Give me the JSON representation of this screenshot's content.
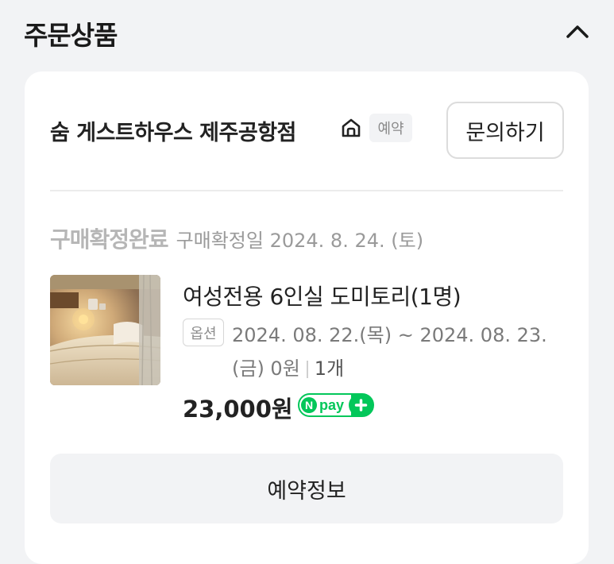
{
  "section": {
    "title": "주문상품",
    "collapse_icon": "chevron-up-icon"
  },
  "store": {
    "name": "숨 게스트하우스 제주공항점",
    "icon": "home-icon",
    "badge": "예약",
    "inquiry_label": "문의하기"
  },
  "order": {
    "status": "구매확정완료",
    "confirm_date": "구매확정일 2024. 8. 24. (토)"
  },
  "product": {
    "thumbnail": "dormitory-room-photo",
    "title": "여성전용 6인실 도미토리(1명)",
    "option_label": "옵션",
    "option_line1": "2024. 08. 22.(목) ~ 2024. 08. 23.",
    "option_line2": "(금) 0원",
    "quantity": "1개",
    "price": "23,000원",
    "npay_label": "pay",
    "npay_icon": "npay-plus-logo"
  },
  "actions": {
    "reservation_info_label": "예약정보"
  },
  "colors": {
    "background": "#f2f3f5",
    "card": "#ffffff",
    "npay_green": "#03c75a",
    "muted_text": "#7a7a7a"
  }
}
